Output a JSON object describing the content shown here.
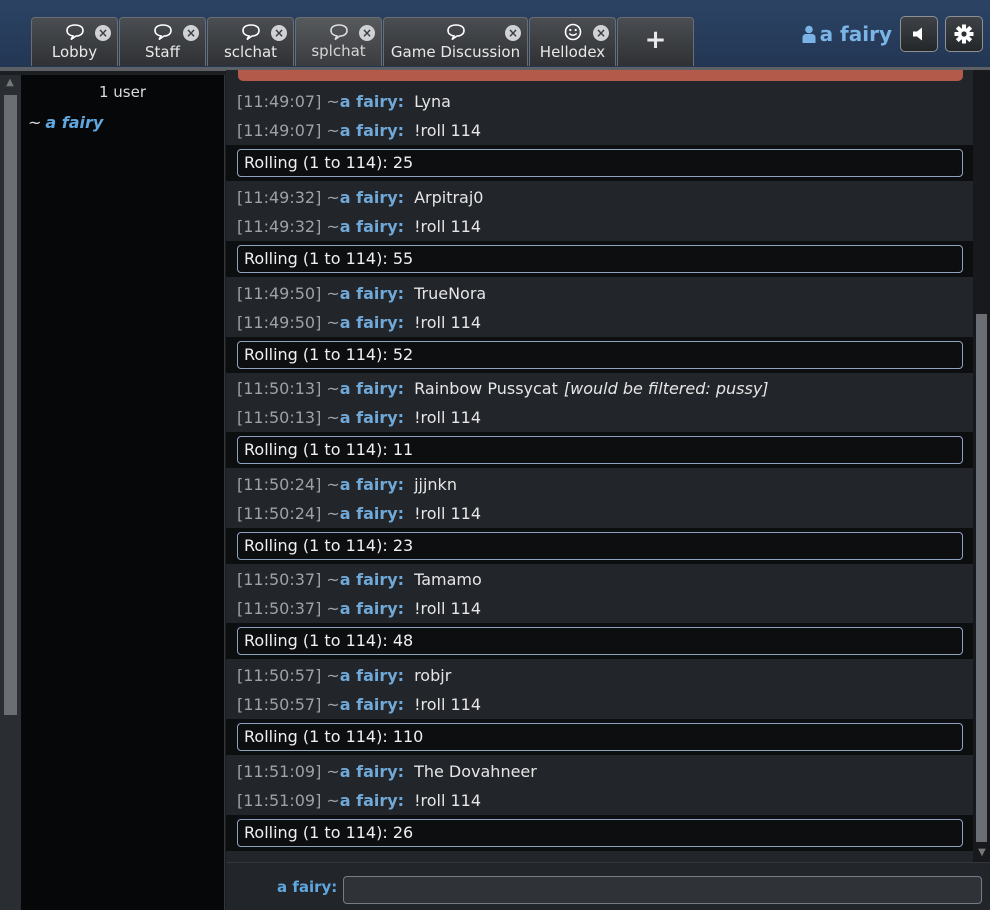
{
  "tabs": [
    {
      "label": "Lobby",
      "icon": "speech-bubble-icon",
      "closable": true,
      "active": false
    },
    {
      "label": "Staff",
      "icon": "speech-bubble-icon",
      "closable": true,
      "active": false
    },
    {
      "label": "sclchat",
      "icon": "speech-bubble-icon",
      "closable": true,
      "active": false
    },
    {
      "label": "splchat",
      "icon": "speech-bubble-icon",
      "closable": true,
      "active": true
    },
    {
      "label": "Game Discussion",
      "icon": "speech-bubble-icon",
      "closable": true,
      "active": false
    },
    {
      "label": "Hellodex",
      "icon": "smiley-icon",
      "closable": true,
      "active": false
    }
  ],
  "new_tab_label": "+",
  "user": {
    "name": "a fairy",
    "icon": "user-icon"
  },
  "controls": {
    "sound_icon": "speaker-icon",
    "settings_icon": "gear-icon"
  },
  "userlist": {
    "count_text": "1 user",
    "users": [
      {
        "rank": "~",
        "name": "a fairy"
      }
    ]
  },
  "chat": {
    "messages": [
      {
        "time": "[11:49:07]",
        "rank": "~",
        "author": "a fairy:",
        "text": "Lyna",
        "command_time": "[11:49:07]",
        "command": "!roll 114",
        "roll": "Rolling (1 to 114): 25"
      },
      {
        "time": "[11:49:32]",
        "rank": "~",
        "author": "a fairy:",
        "text": "Arpitraj0",
        "command_time": "[11:49:32]",
        "command": "!roll 114",
        "roll": "Rolling (1 to 114): 55"
      },
      {
        "time": "[11:49:50]",
        "rank": "~",
        "author": "a fairy:",
        "text": "TrueNora",
        "command_time": "[11:49:50]",
        "command": "!roll 114",
        "roll": "Rolling (1 to 114): 52"
      },
      {
        "time": "[11:50:13]",
        "rank": "~",
        "author": "a fairy:",
        "text": "Rainbow Pussycat",
        "filter_note": "[would be filtered: pussy]",
        "command_time": "[11:50:13]",
        "command": "!roll 114",
        "roll": "Rolling (1 to 114): 11"
      },
      {
        "time": "[11:50:24]",
        "rank": "~",
        "author": "a fairy:",
        "text": "jjjnkn",
        "command_time": "[11:50:24]",
        "command": "!roll 114",
        "roll": "Rolling (1 to 114): 23"
      },
      {
        "time": "[11:50:37]",
        "rank": "~",
        "author": "a fairy:",
        "text": "Tamamo",
        "command_time": "[11:50:37]",
        "command": "!roll 114",
        "roll": "Rolling (1 to 114): 48"
      },
      {
        "time": "[11:50:57]",
        "rank": "~",
        "author": "a fairy:",
        "text": "robjr",
        "command_time": "[11:50:57]",
        "command": "!roll 114",
        "roll": "Rolling (1 to 114): 110"
      },
      {
        "time": "[11:51:09]",
        "rank": "~",
        "author": "a fairy:",
        "text": "The Dovahneer",
        "command_time": "[11:51:09]",
        "command": "!roll 114",
        "roll": "Rolling (1 to 114): 26"
      }
    ]
  },
  "input": {
    "label": "a fairy:",
    "value": "",
    "placeholder": ""
  },
  "colors": {
    "header": "#2c4364",
    "username": "#70a8d8",
    "roll_border": "#8da3bf",
    "background": "#22252a"
  }
}
